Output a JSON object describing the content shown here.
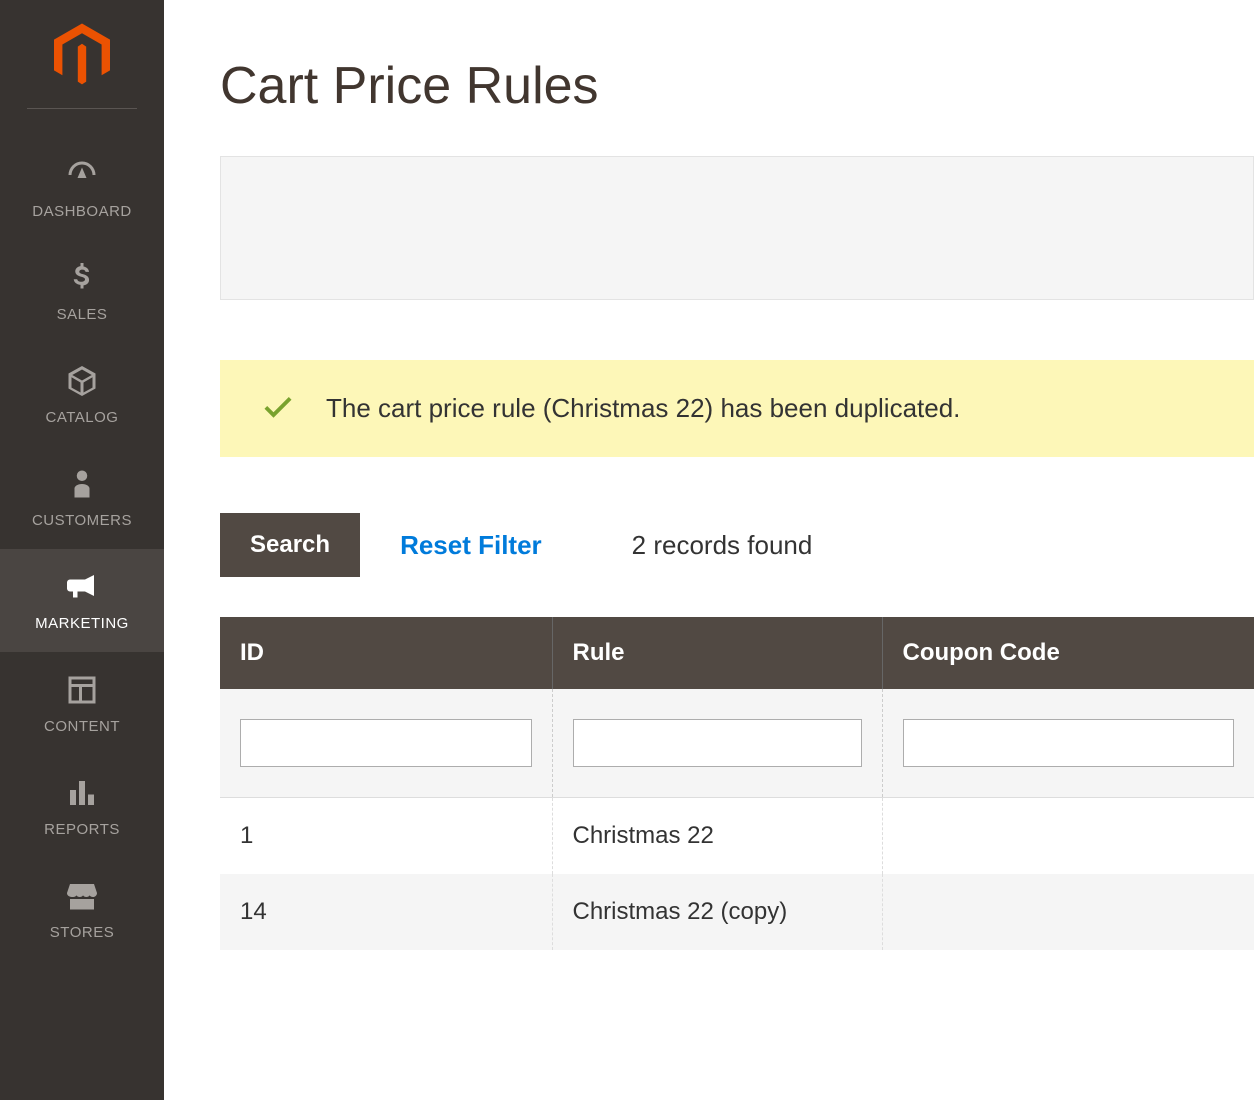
{
  "sidebar": {
    "items": [
      {
        "label": "DASHBOARD"
      },
      {
        "label": "SALES"
      },
      {
        "label": "CATALOG"
      },
      {
        "label": "CUSTOMERS"
      },
      {
        "label": "MARKETING"
      },
      {
        "label": "CONTENT"
      },
      {
        "label": "REPORTS"
      },
      {
        "label": "STORES"
      }
    ]
  },
  "page": {
    "title": "Cart Price Rules"
  },
  "message": {
    "text": "The cart price rule (Christmas 22) has been duplicated."
  },
  "toolbar": {
    "search_label": "Search",
    "reset_label": "Reset Filter",
    "records_text": "2 records found"
  },
  "table": {
    "columns": {
      "id": "ID",
      "rule": "Rule",
      "coupon": "Coupon Code"
    },
    "rows": [
      {
        "id": "1",
        "rule": "Christmas 22",
        "coupon": ""
      },
      {
        "id": "14",
        "rule": "Christmas 22 (copy)",
        "coupon": ""
      }
    ]
  }
}
